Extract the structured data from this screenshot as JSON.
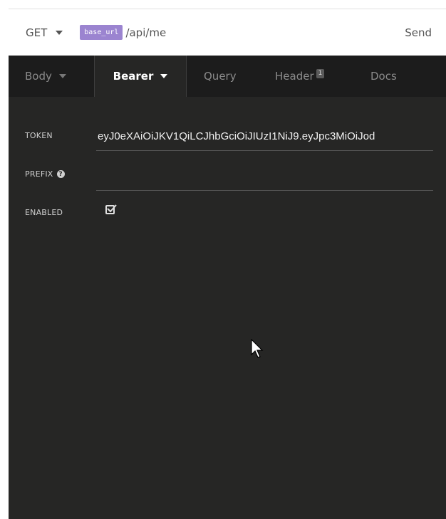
{
  "request": {
    "method": "GET",
    "base_var": "base_url",
    "path": "/api/me",
    "send_label": "Send"
  },
  "tabs": [
    {
      "label": "Body",
      "has_dropdown": true,
      "active": false
    },
    {
      "label": "Bearer",
      "has_dropdown": true,
      "active": true
    },
    {
      "label": "Query",
      "active": false
    },
    {
      "label": "Header",
      "badge": "1",
      "active": false
    },
    {
      "label": "Docs",
      "active": false
    }
  ],
  "auth": {
    "token_label": "TOKEN",
    "token_value": "eyJ0eXAiOiJKV1QiLCJhbGciOiJIUzI1NiJ9.eyJpc3MiOiJod",
    "prefix_label": "PREFIX",
    "prefix_value": "",
    "enabled_label": "ENABLED",
    "enabled": true
  },
  "icons": {
    "method_dropdown": "chevron-down-icon",
    "prefix_help": "question-circle-icon",
    "enabled_check": "checkbox-checked-icon",
    "pointer": "mouse-cursor-icon"
  },
  "colors": {
    "panel_bg": "#262625",
    "tab_bar_bg": "#1c1c1c",
    "variable_tag": "#9b84d0"
  }
}
